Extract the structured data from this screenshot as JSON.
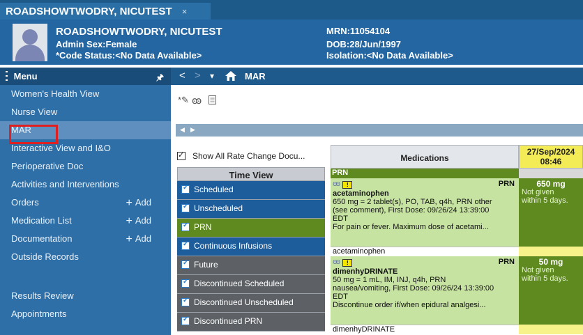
{
  "tab": {
    "label": "ROADSHOWTWODRY, NICUTEST",
    "close": "×"
  },
  "banner": {
    "name": "ROADSHOWTWODRY, NICUTEST",
    "admin_sex": "Admin Sex:Female",
    "code_status": "*Code Status:<No Data Available>",
    "mrn": "MRN:11054104",
    "dob": "DOB:28/Jun/1997",
    "isolation": "Isolation:<No Data Available>"
  },
  "menu": {
    "title": "Menu",
    "pin": "🖈",
    "items": [
      {
        "label": "Women's Health View"
      },
      {
        "label": "Nurse View"
      },
      {
        "label": "MAR"
      },
      {
        "label": "Interactive View and I&O"
      },
      {
        "label": "Perioperative Doc"
      },
      {
        "label": "Activities and Interventions"
      },
      {
        "label": "Orders",
        "add": "Add"
      },
      {
        "label": "Medication List",
        "add": "Add"
      },
      {
        "label": "Documentation",
        "add": "Add"
      },
      {
        "label": "Outside Records"
      },
      {
        "label": "Results Review"
      },
      {
        "label": "Appointments"
      }
    ]
  },
  "navbar": {
    "back": "<",
    "forward": ">",
    "dropdown": "▾",
    "title": "MAR"
  },
  "options": {
    "show_all": "Show All Rate Change Docu..."
  },
  "timeview": {
    "header": "Time View",
    "items": [
      {
        "label": "Scheduled"
      },
      {
        "label": "Unscheduled"
      },
      {
        "label": "PRN"
      },
      {
        "label": "Continuous Infusions"
      },
      {
        "label": "Future"
      },
      {
        "label": "Discontinued Scheduled"
      },
      {
        "label": "Discontinued Unscheduled"
      },
      {
        "label": "Discontinued PRN"
      }
    ]
  },
  "medgrid": {
    "col_header": "Medications",
    "date_header_line1": "27/Sep/2024",
    "date_header_line2": "08:46",
    "section": "PRN",
    "meds": [
      {
        "tag": "PRN",
        "name": "acetaminophen",
        "order1": "650 mg = 2 tablet(s), PO, TAB, q4h, PRN other",
        "order2": "(see comment), First Dose: 09/26/24 13:39:00",
        "order3": "EDT",
        "comment": "For pain or fever. Maximum dose of acetami...",
        "short_name": "acetaminophen",
        "dose": "650 mg",
        "status1": "Not given",
        "status2": "within 5 days."
      },
      {
        "tag": "PRN",
        "name": "dimenhyDRINATE",
        "order1": "50 mg = 1 mL, IM, INJ, q4h, PRN",
        "order2": "nausea/vomiting, First Dose: 09/26/24 13:39:00",
        "order3": "EDT",
        "comment": "Discontinue order if/when epidural analgesi...",
        "short_name": "dimenhyDRINATE",
        "dose": "50 mg",
        "status1": "Not given",
        "status2": "within 5 days."
      }
    ]
  }
}
